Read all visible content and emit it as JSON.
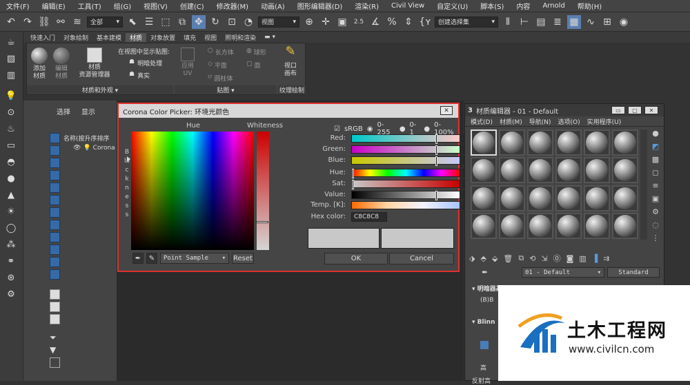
{
  "menu": [
    "文件(F)",
    "编辑(E)",
    "工具(T)",
    "组(G)",
    "视图(V)",
    "创建(C)",
    "修改器(M)",
    "动画(A)",
    "图形编辑器(D)",
    "渲染(R)",
    "Civil View",
    "自定义(U)",
    "脚本(S)",
    "内容",
    "Arnold",
    "帮助(H)"
  ],
  "toolbar": {
    "filter_select": "全部",
    "view_select": "视图",
    "selection_set": "创建选择集",
    "snap_label": "2.5"
  },
  "tabs": [
    "快速入门",
    "对象绘制",
    "基本建模",
    "材质",
    "对象放置",
    "填充",
    "视图",
    "照明和渲染"
  ],
  "active_tab_index": 3,
  "ribbon": {
    "add_material": "添加\n材质",
    "edit_material": "编辑\n材质",
    "material_manager": "材质\n资源管理器",
    "show_in_viewport": "在视图中显示贴图:",
    "shaded": "明暗处理",
    "realistic": "真实",
    "apply_uv": "应用\nUV",
    "box": "长方体",
    "sphere": "球形",
    "plane": "平面",
    "face": "面",
    "cylinder": "圆柱体",
    "viewport_canvas": "视口\n画布",
    "group_materials": "材质和外观",
    "group_maps": "贴图",
    "group_texture": "纹理绘制"
  },
  "scene": {
    "tab_select": "选择",
    "tab_display": "显示",
    "sort_label": "名称(按升序排序",
    "item_corona": "Corona"
  },
  "picker": {
    "title": "Corona Color Picker: 环境光颜色",
    "hue_label": "Hue",
    "whiteness_label": "Whiteness",
    "srgb": "sRGB",
    "range_255": "0-255",
    "range_1": "0-1",
    "range_100": "0-100%",
    "blackness_label": "Blackness",
    "channels": [
      {
        "label": "Red:",
        "value": "200",
        "level": 0.784
      },
      {
        "label": "Green:",
        "value": "200",
        "level": 0.784
      },
      {
        "label": "Blue:",
        "value": "200",
        "level": 0.784
      },
      {
        "label": "Hue:",
        "value": "0",
        "level": 0
      },
      {
        "label": "Sat:",
        "value": "0",
        "level": 0
      },
      {
        "label": "Value:",
        "value": "200",
        "level": 0.784
      }
    ],
    "temp_label": "Temp. [K]:",
    "hex_label": "Hex color:",
    "hex_value": "C8C8C8",
    "sample_mode": "Point Sample",
    "reset": "Reset",
    "ok": "OK",
    "cancel": "Cancel",
    "colors": {
      "current": "#c8c8c8",
      "highlight": "#e03030"
    }
  },
  "material_editor": {
    "number": "3",
    "title": "材质编辑器 - 01 - Default",
    "menu": [
      "模式(D)",
      "材质(M)",
      "导航(N)",
      "选项(O)",
      "实用程序(U)"
    ],
    "material_name": "01 - Default",
    "material_type": "Standard",
    "rollout1": "明暗器基本参数",
    "rollout1_item": "(B)B",
    "rollout2": "Blinn",
    "high_label": "高",
    "reflect_label": "反射高"
  },
  "watermark": {
    "name": "土木工程网",
    "url": "www.civilcn.com"
  }
}
